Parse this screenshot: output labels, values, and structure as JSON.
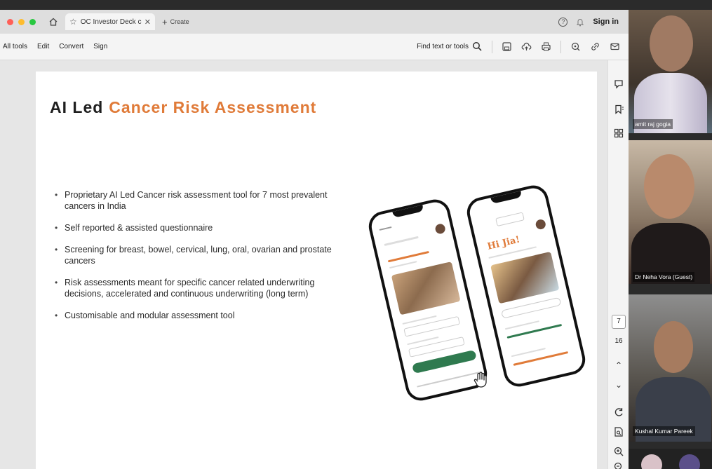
{
  "tabbar": {
    "tab_title": "OC Investor Deck copy...",
    "new_tab_label": "Create",
    "sign_in": "Sign in"
  },
  "toolbar": {
    "menu": [
      "All tools",
      "Edit",
      "Convert",
      "Sign"
    ],
    "find_label": "Find text or tools"
  },
  "slide": {
    "title_main": "AI Led",
    "title_accent": "Cancer Risk Assessment",
    "bullets": [
      "Proprietary AI Led Cancer risk assessment tool for 7 most prevalent cancers in India",
      "Self reported & assisted questionnaire",
      "Screening for breast, bowel, cervical, lung, oral, ovarian and prostate cancers",
      "Risk assessments meant for specific cancer related underwriting decisions, accelerated and continuous underwriting (long term)",
      "Customisable and modular assessment tool"
    ],
    "phone2_greeting": "Hi Jia!"
  },
  "pager": {
    "current_page": "7",
    "total_pages": "16"
  },
  "participants": [
    {
      "name": "amit raj gogia"
    },
    {
      "name": "Dr Neha Vora (Guest)"
    },
    {
      "name": "Kushal Kumar Pareek"
    }
  ],
  "colors": {
    "accent_orange": "#e07b39",
    "app_green": "#2f7a4f"
  }
}
